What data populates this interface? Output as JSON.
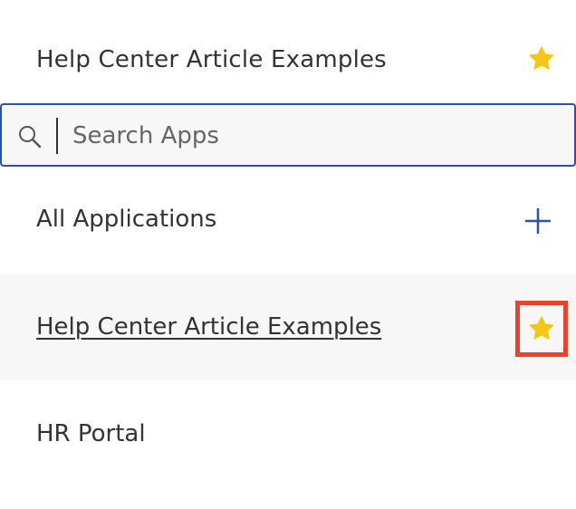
{
  "favorites_header": {
    "title": "Help Center Article Examples",
    "icon": "star-icon"
  },
  "search": {
    "placeholder": "Search Apps",
    "value": "",
    "icon": "search-icon"
  },
  "all_applications": {
    "label": "All Applications",
    "icon": "plus-icon"
  },
  "apps": [
    {
      "label": "Help Center Article Examples",
      "favorited": true,
      "icon": "star-icon"
    },
    {
      "label": "HR Portal",
      "favorited": false
    }
  ],
  "colors": {
    "star": "#f5c518",
    "accent": "#2a53a8",
    "highlight_border": "#e8432e",
    "row_highlight": "#f7f7f7",
    "text": "#333333"
  }
}
